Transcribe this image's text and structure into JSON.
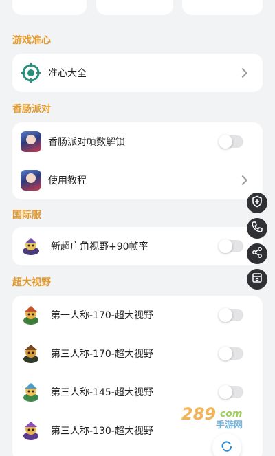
{
  "sections": {
    "crosshair": {
      "title": "游戏准心",
      "items": [
        {
          "label": "准心大全",
          "icon": "crosshair-icon",
          "control": "chevron"
        }
      ]
    },
    "sausage": {
      "title": "香肠派对",
      "items": [
        {
          "label": "香肠派对帧数解锁",
          "icon": "game-avatar-icon",
          "control": "toggle",
          "on": false
        },
        {
          "label": "使用教程",
          "icon": "game-avatar-icon",
          "control": "chevron"
        }
      ]
    },
    "international": {
      "title": "国际服",
      "items": [
        {
          "label": "新超广角视野+90帧率",
          "icon": "character-icon",
          "control": "toggle",
          "on": false
        }
      ]
    },
    "wideview": {
      "title": "超大视野",
      "items": [
        {
          "label": "第一人称-170-超大视野",
          "icon": "character-icon",
          "control": "toggle",
          "on": false
        },
        {
          "label": "第三人称-170-超大视野",
          "icon": "character-icon",
          "control": "toggle",
          "on": false
        },
        {
          "label": "第三人称-145-超大视野",
          "icon": "character-icon",
          "control": "toggle",
          "on": false
        },
        {
          "label": "第三人称-130-超大视野",
          "icon": "character-icon",
          "control": "toggle",
          "on": false
        }
      ]
    }
  },
  "floating_actions": [
    {
      "icon": "shield-plus-icon"
    },
    {
      "icon": "phone-icon"
    },
    {
      "icon": "share-icon"
    },
    {
      "icon": "store-icon"
    }
  ],
  "watermark": {
    "number": "289",
    "suffix": "com",
    "text": "手游网"
  },
  "colors": {
    "accent": "#e39a2c",
    "background": "#f2f3f5",
    "fab": "#2f3135"
  }
}
